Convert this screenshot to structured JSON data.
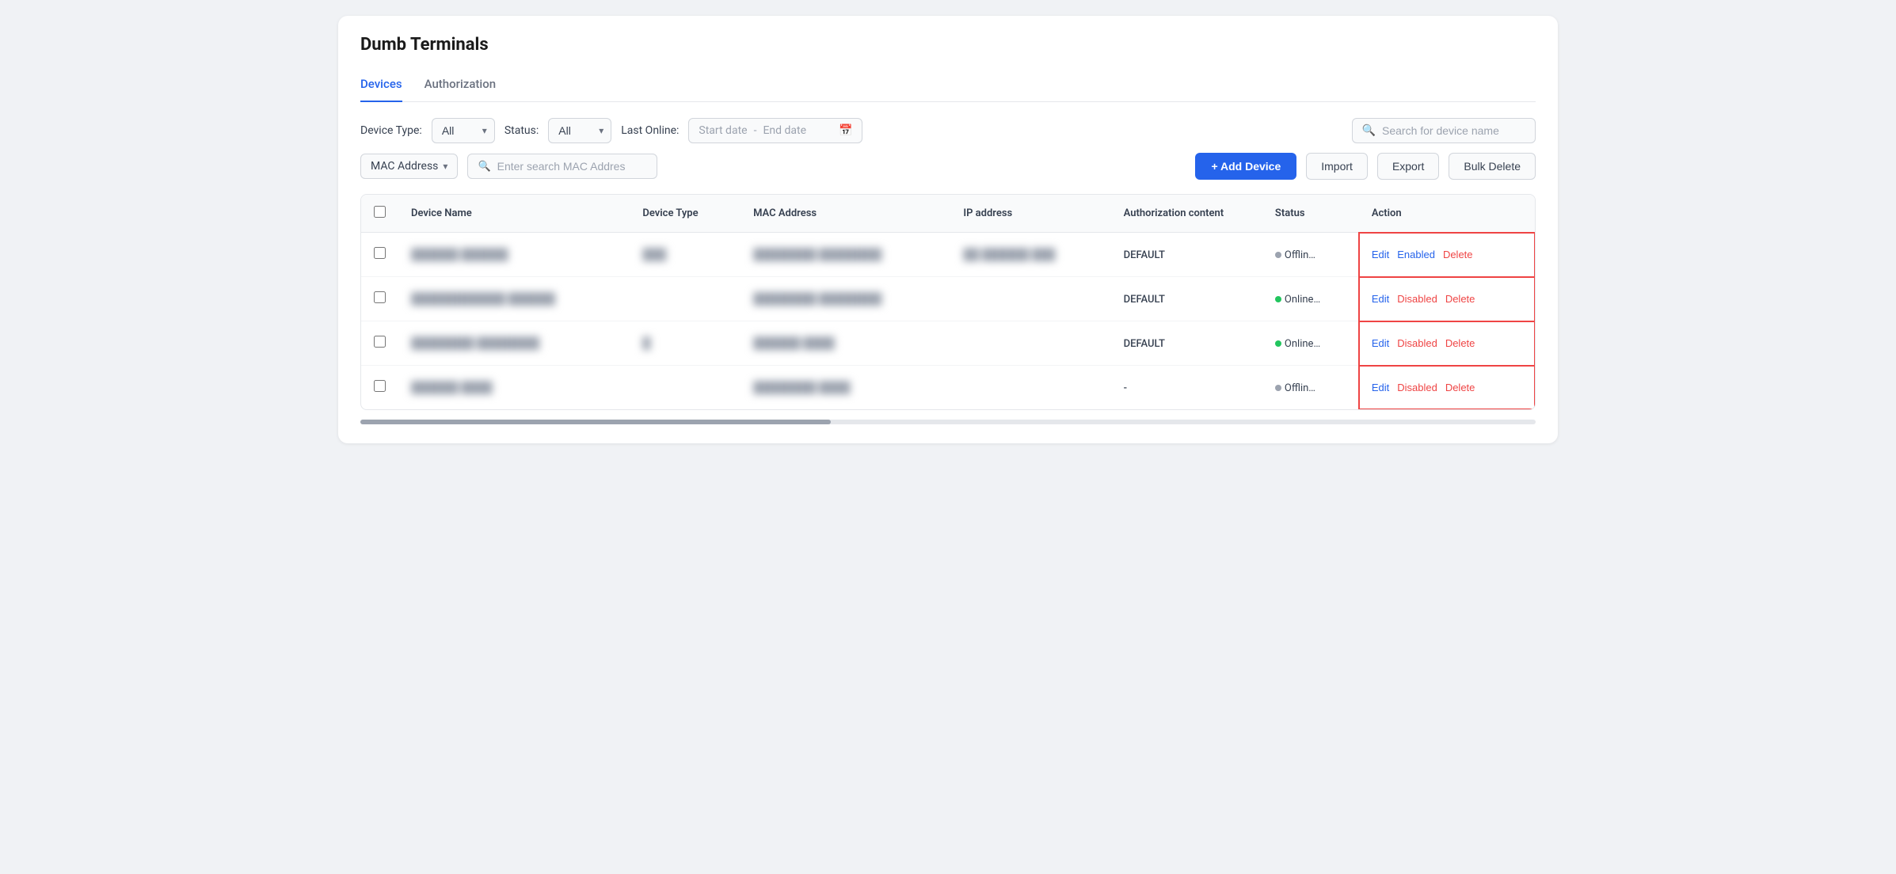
{
  "page": {
    "title": "Dumb Terminals"
  },
  "tabs": [
    {
      "id": "devices",
      "label": "Devices",
      "active": true
    },
    {
      "id": "authorization",
      "label": "Authorization",
      "active": false
    }
  ],
  "filters": {
    "device_type_label": "Device Type:",
    "device_type_value": "All",
    "status_label": "Status:",
    "status_value": "All",
    "last_online_label": "Last Online:",
    "start_date_placeholder": "Start date",
    "end_date_placeholder": "End date",
    "search_placeholder": "Search for device name"
  },
  "mac_search": {
    "mac_option": "MAC Address",
    "mac_placeholder": "Enter search MAC Addres"
  },
  "toolbar": {
    "add_device_label": "+ Add Device",
    "import_label": "Import",
    "export_label": "Export",
    "bulk_delete_label": "Bulk Delete"
  },
  "table": {
    "columns": [
      {
        "id": "checkbox",
        "label": ""
      },
      {
        "id": "device_name",
        "label": "Device Name"
      },
      {
        "id": "device_type",
        "label": "Device Type"
      },
      {
        "id": "mac_address",
        "label": "MAC Address"
      },
      {
        "id": "ip_address",
        "label": "IP address"
      },
      {
        "id": "auth_content",
        "label": "Authorization content"
      },
      {
        "id": "status",
        "label": "Status"
      },
      {
        "id": "action",
        "label": "Action"
      }
    ],
    "rows": [
      {
        "id": 1,
        "device_name": "██████ ██████",
        "device_type": "███",
        "mac_address": "████████ ████████",
        "ip_address": "██ ██████ ███",
        "auth_content": "DEFAULT",
        "status": "Offline",
        "status_type": "offline",
        "action_state": "Enabled"
      },
      {
        "id": 2,
        "device_name": "████████████ ██████",
        "device_type": "",
        "mac_address": "████████ ████████",
        "ip_address": "",
        "auth_content": "DEFAULT",
        "status": "Online",
        "status_type": "online",
        "action_state": "Disabled"
      },
      {
        "id": 3,
        "device_name": "████████ ████████",
        "device_type": "█",
        "mac_address": "██████ ████",
        "ip_address": "",
        "auth_content": "DEFAULT",
        "status": "Online",
        "status_type": "online",
        "action_state": "Disabled"
      },
      {
        "id": 4,
        "device_name": "██████ ████",
        "device_type": "",
        "mac_address": "████████ ████",
        "ip_address": "",
        "auth_content": "-",
        "status": "Offline",
        "status_type": "offline",
        "action_state": "Disabled"
      }
    ]
  },
  "action_buttons": {
    "edit_label": "Edit",
    "enabled_label": "Enabled",
    "disabled_label": "Disabled",
    "delete_label": "Delete"
  }
}
